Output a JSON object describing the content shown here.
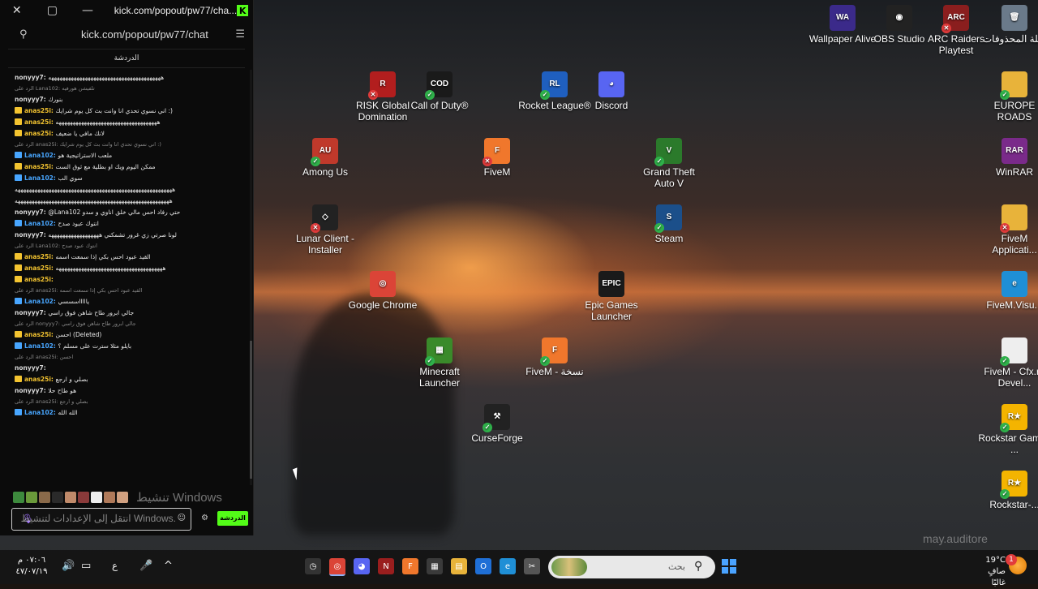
{
  "chat_window": {
    "title": "kick.com/popout/pw77/cha...",
    "url": "kick.com/popout/pw77/chat",
    "header": "الدردشة",
    "messages": [
      {
        "user": "nonyyy7:",
        "text": "ههههههههههههههههههههههههههههههههههههههههه",
        "reply": ""
      },
      {
        "user": "",
        "text": "",
        "reply": "الرد على Lana102: تلفيشن هورفيه"
      },
      {
        "user": "nonyyy7:",
        "text": "بنورك",
        "reply": ""
      },
      {
        "user": "anas25i:",
        "text": "اني نسوي تحدي انا وانت بث كل يوم شرايك :)",
        "reply": ""
      },
      {
        "user": "anas25i:",
        "text": "ههههههههههههههههههههههههههههههههههههه",
        "reply": ""
      },
      {
        "user": "anas25i:",
        "text": "لانك مافي يا ضعيف",
        "reply": ""
      },
      {
        "user": "",
        "text": "",
        "reply": "الرد على anas25i: اني نسوي تحدي انا وانت بث كل يوم شرايك :)"
      },
      {
        "user": "Lana102:",
        "text": "ملعب الاستراتيجية هو",
        "reply": ""
      },
      {
        "user": "anas25i:",
        "text": "ممكن اليوم ويك او بطلية مع ثوق الست",
        "reply": ""
      },
      {
        "user": "Lana102:",
        "text": "سوي الب",
        "reply": ""
      },
      {
        "user": "",
        "text": "ههههههههههههههههههههههههههههههههههههههههههههههههههههههههه",
        "reply": ""
      },
      {
        "user": "",
        "text": "هههههههههههههههههههههههههههههههههههههههههههههههههههههههه",
        "reply": ""
      },
      {
        "user": "nonyyy7:",
        "text": "@Lana102 حتي رفاد احس مالي خلق اناوي و سدو",
        "reply": ""
      },
      {
        "user": "Lana102:",
        "text": "انتوك عبود صدح",
        "reply": ""
      },
      {
        "user": "nonyyy7:",
        "text": "لونا صرتي زي غرور تشمكني ههههههههههههههههههه",
        "reply": ""
      },
      {
        "user": "",
        "text": "",
        "reply": "الرد على Lana102: انتوك عبود صدح"
      },
      {
        "user": "anas25i:",
        "text": "القيد عبود احس بكي إذا سمعت اسمه",
        "reply": ""
      },
      {
        "user": "anas25i:",
        "text": "ههههههههههههههههههههههههههههههههههههههه",
        "reply": ""
      },
      {
        "user": "anas25i:",
        "text": "",
        "reply": ""
      },
      {
        "user": "",
        "text": "",
        "reply": "الرد على anas25i: القيد عبود احس بكي إذا سمعت اسمه"
      },
      {
        "user": "Lana102:",
        "text": "ياااااسسسي",
        "reply": ""
      },
      {
        "user": "nonyyy7:",
        "text": "جالي ابرور طاح شاهن فوق راسي",
        "reply": ""
      },
      {
        "user": "",
        "text": "",
        "reply": "الرد على nonyyy7: جالي ابرور طاح شاهن فوق راسي"
      },
      {
        "user": "anas25i:",
        "text": "احسن (Deleted)",
        "reply": ""
      },
      {
        "user": "Lana102:",
        "text": "بايلو مثلا سترت على مسلم ؟",
        "reply": ""
      },
      {
        "user": "",
        "text": "",
        "reply": "الرد على anas25i: احسن"
      },
      {
        "user": "nonyyy7:",
        "text": "",
        "reply": ""
      },
      {
        "user": "anas25i:",
        "text": "بصلي و ارجع",
        "reply": ""
      },
      {
        "user": "nonyyy7:",
        "text": "هو طاح حلا",
        "reply": ""
      },
      {
        "user": "",
        "text": "",
        "reply": "الرد على anas25i: بصلي و ارجع"
      },
      {
        "user": "Lana102:",
        "text": "الله الله",
        "reply": ""
      }
    ],
    "input_placeholder": "انتقل إلى الإعدادات لتنشيط Windows.",
    "send_label": "الدردشة",
    "activate_overlay": "تنشيط Windows"
  },
  "desktop_icons": [
    {
      "label": "Wallpaper Alive",
      "icon": "wallpaper-alive-icon",
      "color": "#3b2a8a",
      "glyph": "WA",
      "overlay": ""
    },
    {
      "label": "OBS Studio",
      "icon": "obs-icon",
      "color": "#222222",
      "glyph": "◉",
      "overlay": ""
    },
    {
      "label": "ARC Raiders Playtest",
      "icon": "arc-raiders-icon",
      "color": "#8a1e1e",
      "glyph": "ARC",
      "overlay": "x"
    },
    {
      "label": "سلة المحذوفات",
      "icon": "recycle-bin-icon",
      "color": "#6a7a8a",
      "glyph": "🗑",
      "overlay": ""
    },
    {
      "label": "RISK Global Domination",
      "icon": "risk-icon",
      "color": "#b21e1e",
      "glyph": "R",
      "overlay": "x"
    },
    {
      "label": "Call of Duty®",
      "icon": "call-of-duty-icon",
      "color": "#1a1a1a",
      "glyph": "COD",
      "overlay": "ok"
    },
    {
      "label": "Rocket League®",
      "icon": "rocket-league-icon",
      "color": "#1f5fbf",
      "glyph": "RL",
      "overlay": "ok"
    },
    {
      "label": "Discord",
      "icon": "discord-icon",
      "color": "#5865f2",
      "glyph": "◕",
      "overlay": ""
    },
    {
      "label": "EUROPE ROADS",
      "icon": "folder-icon",
      "color": "#e8b33a",
      "glyph": "",
      "overlay": "ok"
    },
    {
      "label": "Among Us",
      "icon": "among-us-icon",
      "color": "#c0392b",
      "glyph": "AU",
      "overlay": "ok"
    },
    {
      "label": "FiveM",
      "icon": "fivem-icon",
      "color": "#f0772c",
      "glyph": "F",
      "overlay": "x"
    },
    {
      "label": "Grand Theft Auto V",
      "icon": "gta-icon",
      "color": "#2b7a2b",
      "glyph": "V",
      "overlay": "ok"
    },
    {
      "label": "WinRAR",
      "icon": "winrar-icon",
      "color": "#7a2a8a",
      "glyph": "RAR",
      "overlay": ""
    },
    {
      "label": "Lunar Client - Installer",
      "icon": "lunar-client-icon",
      "color": "#222222",
      "glyph": "◇",
      "overlay": "x"
    },
    {
      "label": "Steam",
      "icon": "steam-icon",
      "color": "#1b4f8a",
      "glyph": "S",
      "overlay": "ok"
    },
    {
      "label": "FiveM Applicati...",
      "icon": "folder-icon",
      "color": "#e8b33a",
      "glyph": "",
      "overlay": "x"
    },
    {
      "label": "Google Chrome",
      "icon": "chrome-icon",
      "color": "#db4437",
      "glyph": "◎",
      "overlay": ""
    },
    {
      "label": "Epic Games Launcher",
      "icon": "epic-games-icon",
      "color": "#1a1a1a",
      "glyph": "EPIC",
      "overlay": ""
    },
    {
      "label": "FiveM.Visu...",
      "icon": "edge-icon",
      "color": "#1f8fd6",
      "glyph": "e",
      "overlay": ""
    },
    {
      "label": "Minecraft Launcher",
      "icon": "minecraft-icon",
      "color": "#3a8a2a",
      "glyph": "▦",
      "overlay": "ok"
    },
    {
      "label": "FiveM - نسخة",
      "icon": "fivem-icon",
      "color": "#f0772c",
      "glyph": "F",
      "overlay": "ok"
    },
    {
      "label": "FiveM - Cfx.re Devel...",
      "icon": "file-icon",
      "color": "#eeeeee",
      "glyph": "",
      "overlay": "ok"
    },
    {
      "label": "CurseForge",
      "icon": "curseforge-icon",
      "color": "#222222",
      "glyph": "⚒",
      "overlay": "ok"
    },
    {
      "label": "Rockstar Games ...",
      "icon": "rockstar-icon",
      "color": "#f4b400",
      "glyph": "R★",
      "overlay": "ok"
    },
    {
      "label": "Rockstar-...",
      "icon": "rockstar-icon",
      "color": "#f4b400",
      "glyph": "R★",
      "overlay": "ok"
    }
  ],
  "watermark": "may.auditore",
  "taskbar": {
    "time": "٠٧:٠٦ م",
    "date": "٤٧/٠٧/١٩",
    "lang": "ع",
    "search_placeholder": "بحث",
    "weather_temp": "19°C",
    "weather_desc": "صافٍ غالبًا",
    "notif_count": "1"
  },
  "colors": {
    "kick_green": "#53fc18",
    "user_gold": "#f4c430",
    "user_blue": "#48a6ff"
  }
}
